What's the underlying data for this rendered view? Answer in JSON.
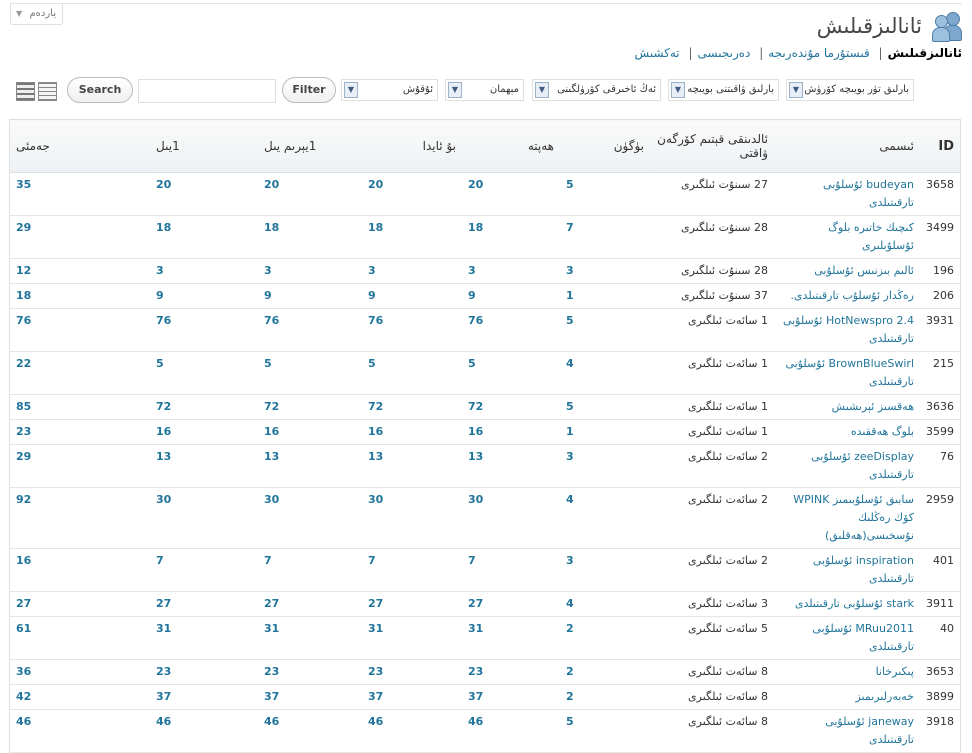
{
  "help_tab": {
    "label": "ياردەم"
  },
  "page": {
    "title": "ئانالىزقىلىش"
  },
  "subsub": [
    {
      "label": "ئانالىزقىلىش",
      "current": true
    },
    {
      "label": "قىستۇرما مۇندەرىجە",
      "current": false
    },
    {
      "label": "دەرىجىسى",
      "current": false
    },
    {
      "label": "تەكشىش",
      "current": false
    }
  ],
  "filters": {
    "time_select": "بارلىق ۋاقىتنى بويىچە",
    "type_select": "بارلىق تۈر بويىچە كۆرۈش",
    "sort_select": "ئەڭ ئاخىرقى كۆرۈلگىنى",
    "user_select": "مېھمان",
    "select5": "ئۇقۇش",
    "filter_button": "Filter",
    "search_value": "",
    "search_button": "Search"
  },
  "table": {
    "headers": {
      "id": "ID",
      "name": "ئىسمى",
      "date": "ئالدىنقى قېتىم كۆرگەن ۋاقتى",
      "today": "بۈگۈن",
      "week": "ھەپتە",
      "month": "بۇ ئايدا",
      "halfyear": "1يېرىم يىل",
      "year": "1يىل",
      "total": "جەمئى"
    },
    "rows": [
      {
        "id": "3658",
        "name": "budeyan ئۇسلۇبى تارقىتىلدى",
        "date": "27 سىنۇت ئىلگىرى",
        "today": "5",
        "week": "20",
        "month": "20",
        "halfyear": "20",
        "year": "20",
        "total": "35"
      },
      {
        "id": "3499",
        "name": "كىچىك خاتىرە بلوگ ئۇسلۇبلىرى",
        "date": "28 سىنۇت ئىلگىرى",
        "today": "7",
        "week": "18",
        "month": "18",
        "halfyear": "18",
        "year": "18",
        "total": "29"
      },
      {
        "id": "196",
        "name": "ئالىم بىزنىس ئۇسلۇبى",
        "date": "28 سىنۇت ئىلگىرى",
        "today": "3",
        "week": "3",
        "month": "3",
        "halfyear": "3",
        "year": "3",
        "total": "12"
      },
      {
        "id": "206",
        "name": "رەڭدار ئۇسلۇب تارقىتىلدى.",
        "date": "37 سىنۇت ئىلگىرى",
        "today": "1",
        "week": "9",
        "month": "9",
        "halfyear": "9",
        "year": "9",
        "total": "18"
      },
      {
        "id": "3931",
        "name": "HotNewspro 2.4 ئۇسلۇبى تارقىتىلدى",
        "date": "1 سائەت ئىلگىرى",
        "today": "5",
        "week": "76",
        "month": "76",
        "halfyear": "76",
        "year": "76",
        "total": "76"
      },
      {
        "id": "215",
        "name": "BrownBlueSwirl ئۇسلۇبى تارقىتىلدى",
        "date": "1 سائەت ئىلگىرى",
        "today": "4",
        "week": "5",
        "month": "5",
        "halfyear": "5",
        "year": "5",
        "total": "22"
      },
      {
        "id": "3636",
        "name": "ھەقسىز ئېرىشىش",
        "date": "1 سائەت ئىلگىرى",
        "today": "5",
        "week": "72",
        "month": "72",
        "halfyear": "72",
        "year": "72",
        "total": "85"
      },
      {
        "id": "3599",
        "name": "بلوگ ھەققىدە",
        "date": "1 سائەت ئىلگىرى",
        "today": "1",
        "week": "16",
        "month": "16",
        "halfyear": "16",
        "year": "16",
        "total": "23"
      },
      {
        "id": "76",
        "name": "zeeDisplay ئۇسلۇبى تارقىتىلدى",
        "date": "2 سائەت ئىلگىرى",
        "today": "3",
        "week": "13",
        "month": "13",
        "halfyear": "13",
        "year": "13",
        "total": "29"
      },
      {
        "id": "2959",
        "name": "سابىق ئۇسلۇبىمىز WPINK كۆك رەڭلىك نۇسخىسى(ھەقلىق)",
        "date": "2 سائەت ئىلگىرى",
        "today": "4",
        "week": "30",
        "month": "30",
        "halfyear": "30",
        "year": "30",
        "total": "92"
      },
      {
        "id": "401",
        "name": "inspiration ئۇسلۇبى تارقىتىلدى",
        "date": "2 سائەت ئىلگىرى",
        "today": "3",
        "week": "7",
        "month": "7",
        "halfyear": "7",
        "year": "7",
        "total": "16"
      },
      {
        "id": "3911",
        "name": "stark ئۇسلۇبى تارقىتىلدى",
        "date": "3 سائەت ئىلگىرى",
        "today": "4",
        "week": "27",
        "month": "27",
        "halfyear": "27",
        "year": "27",
        "total": "27"
      },
      {
        "id": "40",
        "name": "MRuu2011 ئۇسلۇبى تارقىتىلدى",
        "date": "5 سائەت ئىلگىرى",
        "today": "2",
        "week": "31",
        "month": "31",
        "halfyear": "31",
        "year": "31",
        "total": "61"
      },
      {
        "id": "3653",
        "name": "پىكىرخانا",
        "date": "8 سائەت ئىلگىرى",
        "today": "2",
        "week": "23",
        "month": "23",
        "halfyear": "23",
        "year": "23",
        "total": "36"
      },
      {
        "id": "3899",
        "name": "خەبەرلىرىمىز",
        "date": "8 سائەت ئىلگىرى",
        "today": "2",
        "week": "37",
        "month": "37",
        "halfyear": "37",
        "year": "37",
        "total": "42"
      },
      {
        "id": "3918",
        "name": "janeway ئۇسلۇبى تارقىتىلدى",
        "date": "8 سائەت ئىلگىرى",
        "today": "5",
        "week": "46",
        "month": "46",
        "halfyear": "46",
        "year": "46",
        "total": "46"
      }
    ]
  }
}
